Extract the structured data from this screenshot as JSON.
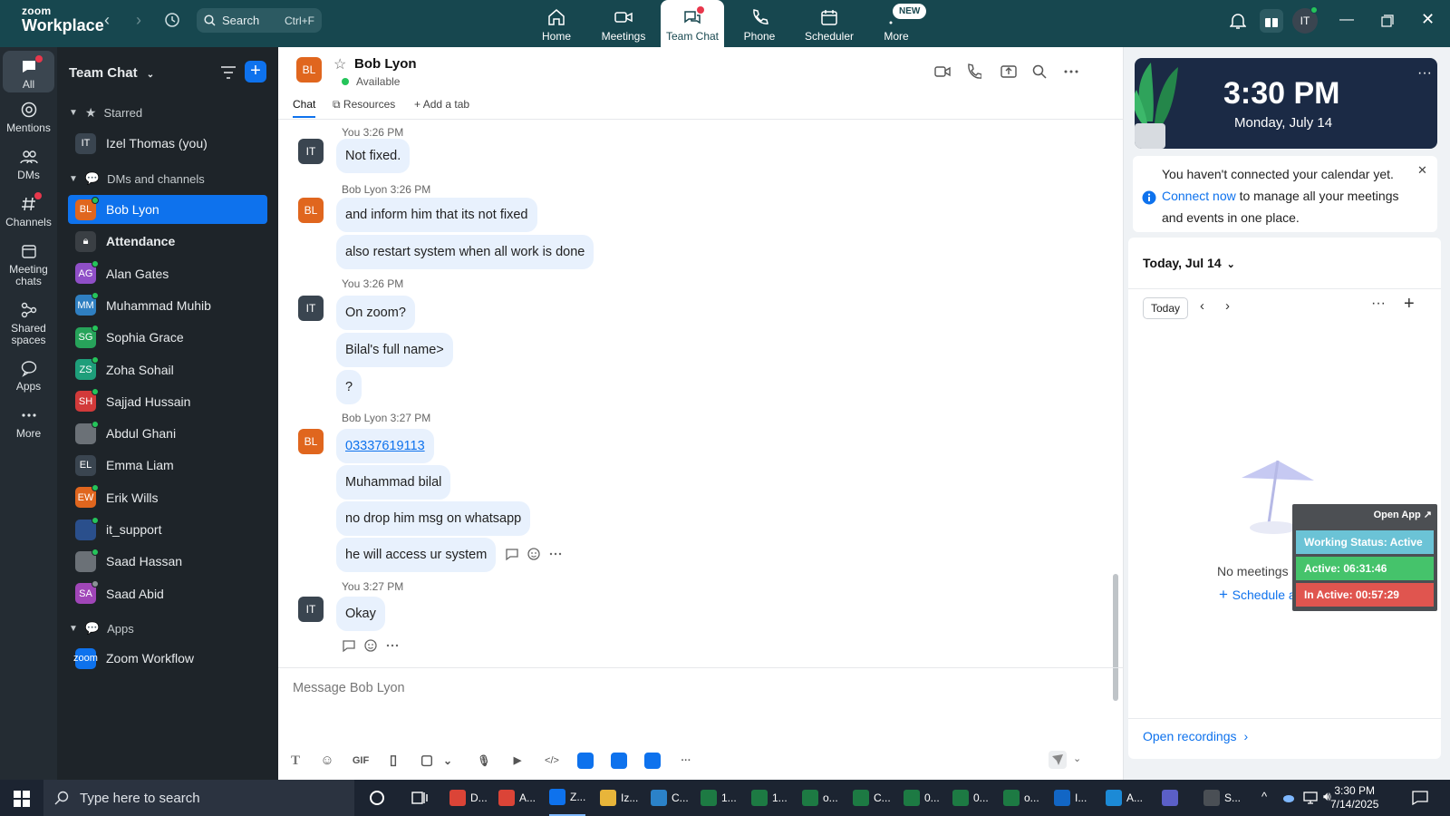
{
  "app": {
    "brand_line1": "zoom",
    "brand_line2": "Workplace",
    "search_label": "Search",
    "search_shortcut": "Ctrl+F",
    "new_badge": "NEW",
    "tabs": [
      {
        "label": "Home",
        "icon": "home-icon"
      },
      {
        "label": "Meetings",
        "icon": "video-camera-icon"
      },
      {
        "label": "Team Chat",
        "icon": "chat-bubbles-icon"
      },
      {
        "label": "Phone",
        "icon": "phone-icon"
      },
      {
        "label": "Scheduler",
        "icon": "calendar-icon"
      },
      {
        "label": "More",
        "icon": "more-icon"
      }
    ],
    "user_initials": "IT",
    "accent": "#0e72ed",
    "topbar_color": "#17474f"
  },
  "rail": [
    {
      "label": "All",
      "icon": "chat-icon"
    },
    {
      "label": "Mentions",
      "icon": "at-icon"
    },
    {
      "label": "DMs",
      "icon": "people-icon"
    },
    {
      "label": "Channels",
      "icon": "hash-icon"
    },
    {
      "label": "Meeting chats",
      "icon": "calendar-icon"
    },
    {
      "label": "Shared spaces",
      "icon": "share-icon"
    },
    {
      "label": "Apps",
      "icon": "speech-icon"
    },
    {
      "label": "More",
      "icon": "ellipsis-icon"
    }
  ],
  "sidebar": {
    "title": "Team Chat",
    "sections": {
      "starred": "Starred",
      "dms": "DMs and channels",
      "apps": "Apps"
    },
    "starred": [
      {
        "initials": "IT",
        "name": "Izel Thomas (you)",
        "color": "#3a4550"
      }
    ],
    "contacts": [
      {
        "initials": "BL",
        "name": "Bob Lyon",
        "color": "#e0661e",
        "status": "online"
      },
      {
        "initials": "",
        "name": "Attendance",
        "color": "#3a3f44",
        "status": "none"
      },
      {
        "initials": "AG",
        "name": "Alan Gates",
        "color": "#8f4fc7",
        "status": "online"
      },
      {
        "initials": "MM",
        "name": "Muhammad Muhib",
        "color": "#2f7fc1",
        "status": "online"
      },
      {
        "initials": "SG",
        "name": "Sophia Grace",
        "color": "#27a35a",
        "status": "online"
      },
      {
        "initials": "ZS",
        "name": "Zoha Sohail",
        "color": "#1e9e7a",
        "status": "online"
      },
      {
        "initials": "SH",
        "name": "Sajjad Hussain",
        "color": "#d23a3a",
        "status": "online"
      },
      {
        "initials": "",
        "name": "Abdul Ghani",
        "color": "#6b7177",
        "status": "online"
      },
      {
        "initials": "EL",
        "name": "Emma Liam",
        "color": "#3a4550",
        "status": "none"
      },
      {
        "initials": "EW",
        "name": "Erik Wills",
        "color": "#e0661e",
        "status": "online"
      },
      {
        "initials": "",
        "name": "it_support",
        "color": "#2a4f8c",
        "status": "online"
      },
      {
        "initials": "",
        "name": "Saad Hassan",
        "color": "#6b7177",
        "status": "online"
      },
      {
        "initials": "SA",
        "name": "Saad Abid",
        "color": "#a046b8",
        "status": "offline"
      }
    ],
    "apps": [
      {
        "initials": "zoom",
        "name": "Zoom Workflow",
        "color": "#0e72ed"
      }
    ]
  },
  "chat": {
    "contact_initials": "BL",
    "contact_name": "Bob Lyon",
    "contact_status": "Available",
    "tabs": [
      "Chat",
      "Resources",
      "Add a tab"
    ],
    "messages": [
      {
        "header": "You 3:26 PM",
        "author": "IT",
        "bubbles": [
          "Not fixed."
        ]
      },
      {
        "header": "Bob Lyon 3:26 PM",
        "author": "BL",
        "bubbles": [
          "and inform him that its not fixed",
          "also restart system when all work is done"
        ]
      },
      {
        "header": "You 3:26 PM",
        "author": "IT",
        "bubbles": [
          "On zoom?",
          "Bilal's full name>",
          "?"
        ]
      },
      {
        "header": "Bob Lyon 3:27 PM",
        "author": "BL",
        "bubbles": [
          "03337619113",
          "Muhammad bilal",
          "no drop him msg on whatsapp",
          "he will access ur system"
        ]
      },
      {
        "header": "You 3:27 PM",
        "author": "IT",
        "bubbles": [
          "Okay"
        ]
      }
    ],
    "composer_placeholder": "Message Bob Lyon",
    "composer_tools": [
      "T",
      "☺",
      "GIF",
      "▯",
      "▢",
      "⌄",
      "🎙",
      "▶",
      "</>",
      "",
      "",
      "",
      "···"
    ]
  },
  "right_panel": {
    "time": "3:30 PM",
    "date": "Monday, July 14",
    "notice_pre": "You haven't connected your calendar yet. ",
    "notice_link": "Connect now",
    "notice_post": " to manage all your meetings and events in one place.",
    "day_label": "Today, Jul 14",
    "today_button": "Today",
    "no_meetings": "No meetings scheduled",
    "schedule": "Schedule a meeting",
    "open_recordings": "Open recordings"
  },
  "status_widget": {
    "open_app": "Open App ↗",
    "working": "Working Status: Active",
    "active": "Active: 06:31:46",
    "inactive": "In Active: 00:57:29",
    "colors": {
      "working": "#6bc3d6",
      "active": "#45c36b",
      "inactive": "#e0554f"
    }
  },
  "taskbar": {
    "search_placeholder": "Type here to search",
    "apps": [
      {
        "label": "D...",
        "icon": "chrome-icon",
        "color": "#db4437"
      },
      {
        "label": "A...",
        "icon": "chrome-icon",
        "color": "#db4437"
      },
      {
        "label": "Z...",
        "icon": "zoom-icon",
        "color": "#0e72ed"
      },
      {
        "label": "Iz...",
        "icon": "folder-icon",
        "color": "#e8b53a"
      },
      {
        "label": "C...",
        "icon": "app-icon",
        "color": "#2b82c9"
      },
      {
        "label": "1...",
        "icon": "excel-icon",
        "color": "#1d7a43"
      },
      {
        "label": "1...",
        "icon": "excel-icon",
        "color": "#1d7a43"
      },
      {
        "label": "o...",
        "icon": "excel-icon",
        "color": "#1d7a43"
      },
      {
        "label": "C...",
        "icon": "excel-icon",
        "color": "#1d7a43"
      },
      {
        "label": "0...",
        "icon": "excel-icon",
        "color": "#1d7a43"
      },
      {
        "label": "0...",
        "icon": "excel-icon",
        "color": "#1d7a43"
      },
      {
        "label": "o...",
        "icon": "excel-icon",
        "color": "#1d7a43"
      },
      {
        "label": "I...",
        "icon": "outlook-icon",
        "color": "#1266c5"
      },
      {
        "label": "A...",
        "icon": "edge-icon",
        "color": "#1c8ad6"
      },
      {
        "label": "",
        "icon": "teams-icon",
        "color": "#5b5fc7"
      },
      {
        "label": "S...",
        "icon": "settings-icon",
        "color": "#4a4f55"
      }
    ],
    "time": "3:30 PM",
    "date": "7/14/2025"
  }
}
